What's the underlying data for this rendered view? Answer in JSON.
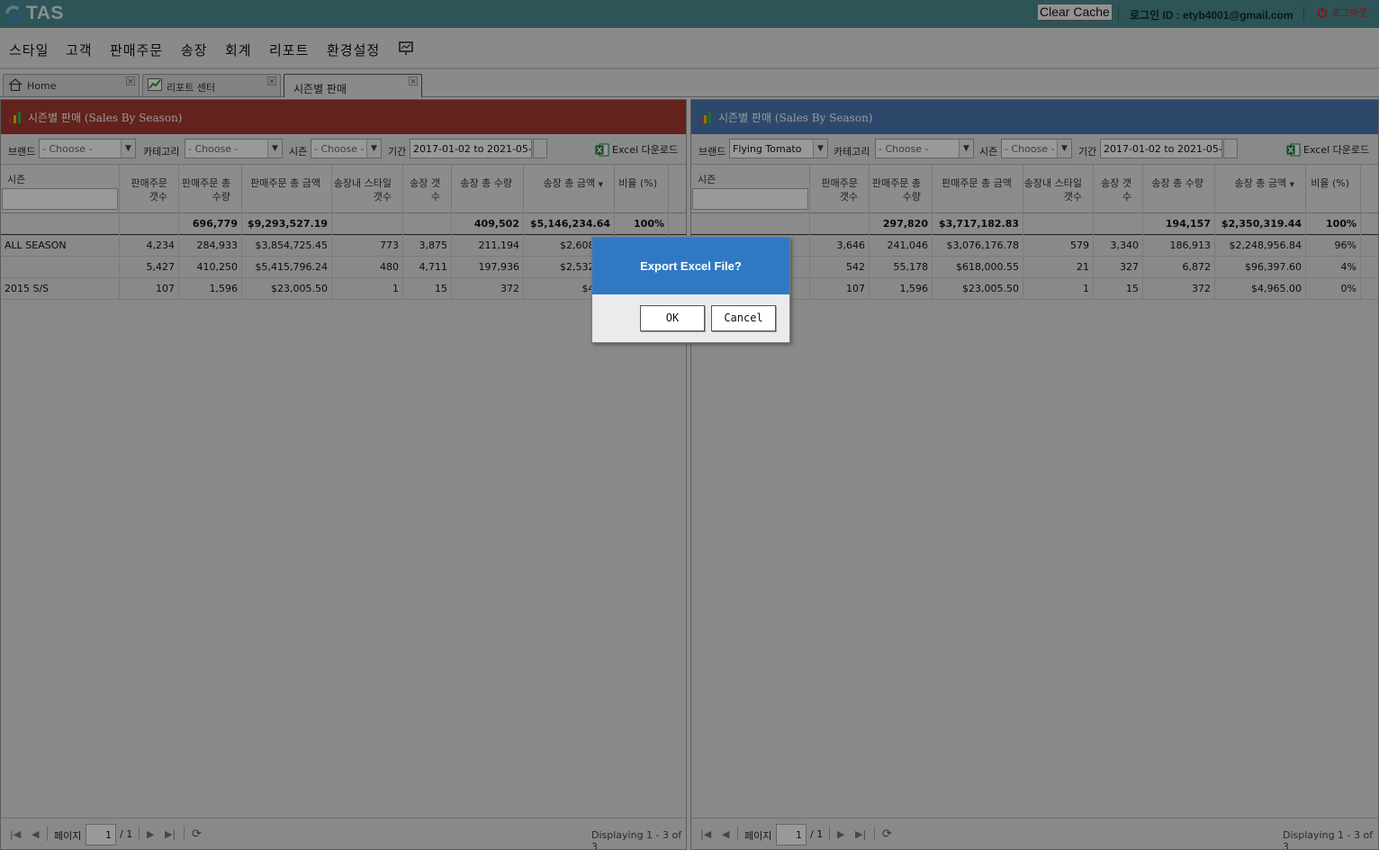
{
  "app": {
    "logo_text": "TAS",
    "clear_cache": "Clear Cache",
    "login_label": "로그인 ID : etyb4001@gmail.com",
    "logout": "로그아웃"
  },
  "menu": [
    "스타일",
    "고객",
    "판매주문",
    "송장",
    "회계",
    "리포트",
    "환경설정"
  ],
  "tabs": [
    {
      "label": "Home",
      "icon": "home-icon"
    },
    {
      "label": "리포트 센터",
      "icon": "chart-icon"
    },
    {
      "label": "시즌별 판매",
      "active": true
    }
  ],
  "colors": {
    "left_title": "#a63a2f",
    "right_title": "#4d79b4",
    "dialog_head": "#3079c2",
    "topbar": "#4c8d91"
  },
  "panels": [
    {
      "title": "시즌별 판매 (Sales By Season)",
      "brand_label": "브랜드",
      "brand_value": "- Choose -",
      "category_label": "카테고리",
      "category_value": "- Choose -",
      "season_label": "시즌",
      "season_value": "- Choose -",
      "period_label": "기간",
      "period_value": "2017-01-02 to 2021-05-30",
      "excel_label": "Excel 다운로드",
      "columns": [
        "시즌",
        "판매주문 갯수",
        "판매주문 총 수량",
        "판매주문 총 금액",
        "송장내 스타일갯수",
        "송장 갯수",
        "송장 총 수량",
        "송장 총 금액",
        "비율 (%)"
      ],
      "summary": [
        "",
        "",
        "696,779",
        "$9,293,527.19",
        "",
        "",
        "409,502",
        "$5,146,234.64",
        "100%"
      ],
      "rows": [
        [
          "ALL SEASON",
          "4,234",
          "284,933",
          "$3,854,725.45",
          "773",
          "3,875",
          "211,194",
          "$2,608,78",
          ""
        ],
        [
          "",
          "5,427",
          "410,250",
          "$5,415,796.24",
          "480",
          "4,711",
          "197,936",
          "$2,532,48",
          ""
        ],
        [
          "2015 S/S",
          "107",
          "1,596",
          "$23,005.50",
          "1",
          "15",
          "372",
          "$4,96",
          ""
        ]
      ],
      "pager": {
        "page_label": "페이지",
        "page": "1",
        "of": "/ 1",
        "display": "Displaying 1 - 3 of 3"
      }
    },
    {
      "title": "시즌별 판매 (Sales By Season)",
      "brand_label": "브랜드",
      "brand_value": "Flying Tomato",
      "category_label": "카테고리",
      "category_value": "- Choose -",
      "season_label": "시즌",
      "season_value": "- Choose -",
      "period_label": "기간",
      "period_value": "2017-01-02 to 2021-05-30",
      "excel_label": "Excel 다운로드",
      "columns": [
        "시즌",
        "판매주문 갯수",
        "판매주문 총 수량",
        "판매주문 총 금액",
        "송장내 스타일갯수",
        "송장 갯수",
        "송장 총 수량",
        "송장 총 금액",
        "비율 (%)"
      ],
      "summary": [
        "",
        "",
        "297,820",
        "$3,717,182.83",
        "",
        "",
        "194,157",
        "$2,350,319.44",
        "100%"
      ],
      "rows": [
        [
          "",
          "3,646",
          "241,046",
          "$3,076,176.78",
          "579",
          "3,340",
          "186,913",
          "$2,248,956.84",
          "96%"
        ],
        [
          "",
          "542",
          "55,178",
          "$618,000.55",
          "21",
          "327",
          "6,872",
          "$96,397.60",
          "4%"
        ],
        [
          "",
          "107",
          "1,596",
          "$23,005.50",
          "1",
          "15",
          "372",
          "$4,965.00",
          "0%"
        ]
      ],
      "pager": {
        "page_label": "페이지",
        "page": "1",
        "of": "/ 1",
        "display": "Displaying 1 - 3 of 3"
      }
    }
  ],
  "dialog": {
    "message": "Export Excel File?",
    "ok": "OK",
    "cancel": "Cancel"
  }
}
